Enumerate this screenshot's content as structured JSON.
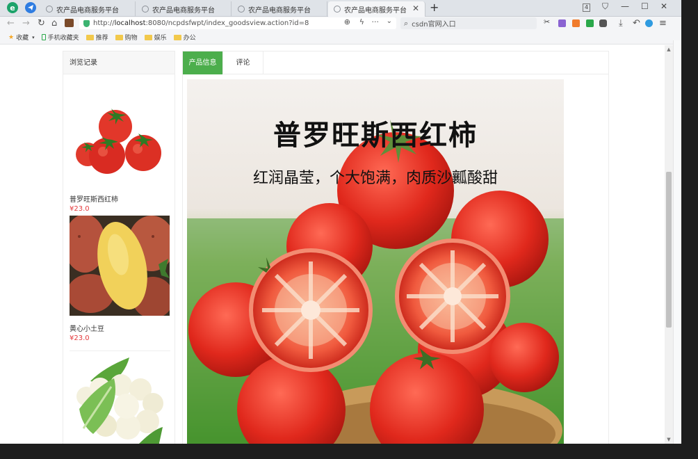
{
  "browser": {
    "tabs": [
      {
        "title": "农产品电商服务平台",
        "active": false
      },
      {
        "title": "农产品电商服务平台",
        "active": false
      },
      {
        "title": "农产品电商服务平台",
        "active": false
      },
      {
        "title": "农产品电商服务平台",
        "active": true
      }
    ],
    "new_tab_label": "+",
    "url_prefix": "http://",
    "url_host": "localhost",
    "url_rest": ":8080/ncpdsfwpt/index_goodsview.action?id=8",
    "search_text": "csdn官网入口",
    "tab_counter": "4"
  },
  "bookmarks": [
    {
      "label": "收藏",
      "icon": "star-icon"
    },
    {
      "label": "手机收藏夹",
      "icon": "phone-icon"
    },
    {
      "label": "推荐",
      "icon": "folder-icon"
    },
    {
      "label": "购物",
      "icon": "folder-icon"
    },
    {
      "label": "娱乐",
      "icon": "folder-icon"
    },
    {
      "label": "办公",
      "icon": "folder-icon"
    }
  ],
  "history": {
    "title": "浏览记录",
    "items": [
      {
        "name": "普罗旺斯西红柿",
        "price": "¥23.0",
        "image": "tomato"
      },
      {
        "name": "黄心小土豆",
        "price": "¥23.0",
        "image": "potato"
      },
      {
        "name": "",
        "price": "",
        "image": "cauliflower"
      }
    ]
  },
  "product": {
    "tabs": [
      {
        "label": "产品信息",
        "active": true
      },
      {
        "label": "评论",
        "active": false
      }
    ],
    "banner_title": "普罗旺斯西红柿",
    "banner_subtitle": "红润晶莹，个大饱满，肉质沙瓤酸甜"
  },
  "colors": {
    "accent_green": "#4cae4c",
    "price_red": "#e4393c"
  }
}
